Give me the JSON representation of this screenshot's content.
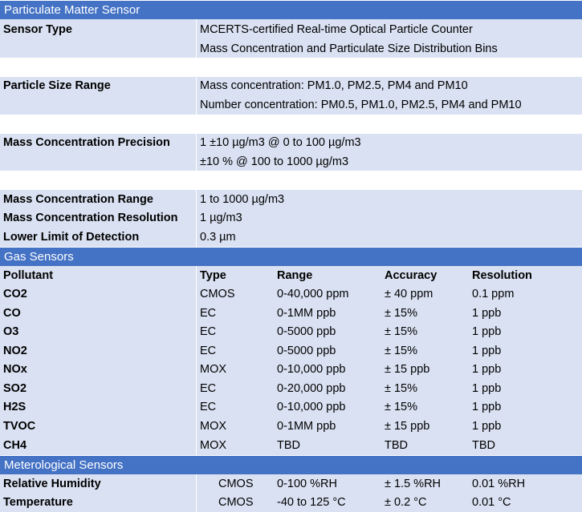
{
  "pm": {
    "title": "Particulate Matter Sensor",
    "rows": [
      {
        "label": "Sensor Type",
        "lines": [
          "MCERTS-certified Real-time Optical Particle Counter",
          "Mass Concentration and Particulate Size Distribution Bins"
        ]
      },
      {
        "label": "Particle Size Range",
        "lines": [
          "Mass concentration: PM1.0, PM2.5, PM4 and PM10",
          "Number concentration: PM0.5, PM1.0, PM2.5, PM4 and PM10"
        ]
      },
      {
        "label": "Mass Concentration Precision",
        "lines": [
          "1 ±10 µg/m3 @ 0 to 100 µg/m3",
          "±10 % @ 100 to 1000 µg/m3"
        ]
      },
      {
        "label": "Mass Concentration Range",
        "lines": [
          "1 to 1000 µg/m3"
        ]
      },
      {
        "label": "Mass Concentration Resolution",
        "lines": [
          "1 µg/m3"
        ]
      },
      {
        "label": "Lower Limit of Detection",
        "lines": [
          "0.3 µm"
        ]
      }
    ]
  },
  "gas": {
    "title": "Gas Sensors",
    "headers": [
      "Pollutant",
      "Type",
      "Range",
      "Accuracy",
      "Resolution"
    ],
    "rows": [
      [
        "CO2",
        "CMOS",
        "0-40,000 ppm",
        "± 40 ppm",
        "0.1 ppm"
      ],
      [
        "CO",
        "EC",
        "0-1MM ppb",
        "± 15%",
        "1 ppb"
      ],
      [
        "O3",
        "EC",
        "0-5000 ppb",
        "± 15%",
        "1 ppb"
      ],
      [
        "NO2",
        "EC",
        "0-5000 ppb",
        "± 15%",
        "1 ppb"
      ],
      [
        "NOx",
        "MOX",
        "0-10,000 ppb",
        "± 15 ppb",
        "1 ppb"
      ],
      [
        "SO2",
        "EC",
        "0-20,000 ppb",
        "± 15%",
        "1 ppb"
      ],
      [
        "H2S",
        "EC",
        "0-10,000 ppb",
        "± 15%",
        "1 ppb"
      ],
      [
        "TVOC",
        "MOX",
        "0-1MM ppb",
        "± 15 ppb",
        "1 ppb"
      ],
      [
        "CH4",
        "MOX",
        "TBD",
        "TBD",
        "TBD"
      ]
    ]
  },
  "met": {
    "title": "Meterological Sensors",
    "rows": [
      [
        "Relative Humidity",
        "CMOS",
        "0-100 %RH",
        "± 1.5 %RH",
        "0.01 %RH"
      ],
      [
        "Temperature",
        "CMOS",
        "-40 to 125 °C",
        "± 0.2 °C",
        "0.01 °C"
      ]
    ]
  }
}
